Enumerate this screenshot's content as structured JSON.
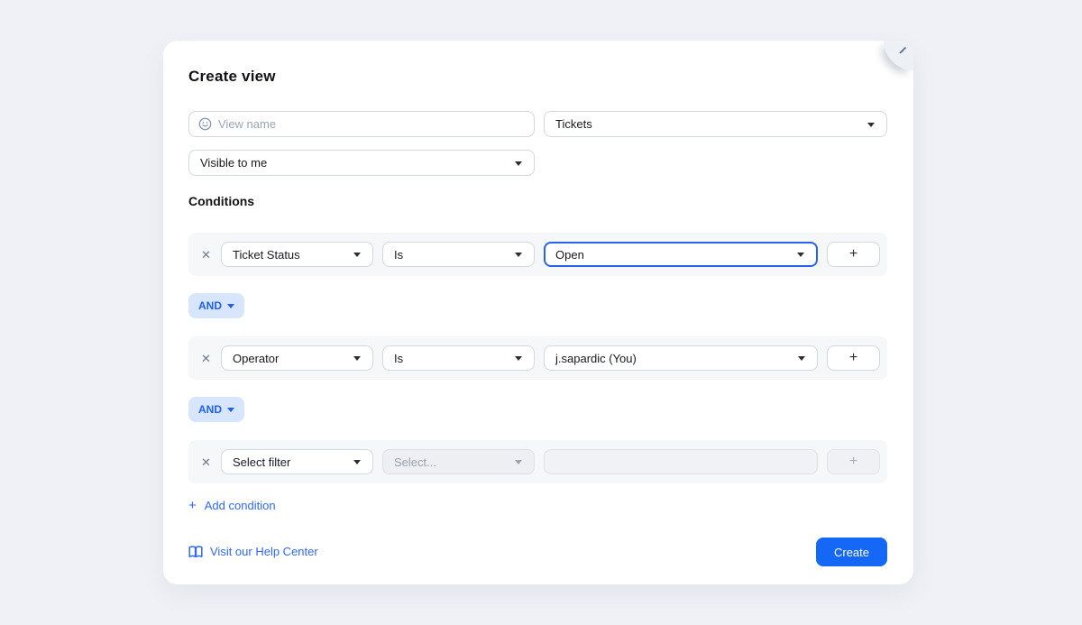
{
  "modal": {
    "title": "Create view",
    "view_name": {
      "placeholder": "View name"
    },
    "type_select": {
      "value": "Tickets"
    },
    "visibility_select": {
      "value": "Visible to me"
    },
    "conditions": {
      "label": "Conditions",
      "and_label": "AND",
      "rows": [
        {
          "filter": "Ticket Status",
          "operator": "Is",
          "value": "Open"
        },
        {
          "filter": "Operator",
          "operator": "Is",
          "value": "j.sapardic (You)"
        },
        {
          "filter": "Select filter",
          "operator": "Select...",
          "value": ""
        }
      ],
      "add_condition_label": "Add condition"
    },
    "footer": {
      "help_link": "Visit our Help Center",
      "create_label": "Create"
    },
    "colors": {
      "accent_blue": "#1567F5",
      "link_blue": "#2E68F5",
      "focus_border": "#2563EB",
      "chip_bg": "#D8E6FD",
      "row_bg": "#F5F7F9",
      "page_bg": "#EFF1F6"
    }
  }
}
